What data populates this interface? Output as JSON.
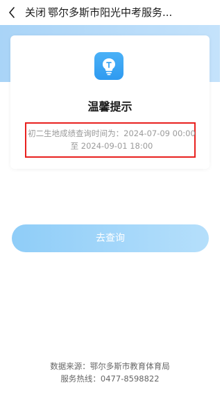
{
  "nav": {
    "back_icon": "chevron-left-icon",
    "close_label": "关闭",
    "title": "鄂尔多斯市阳光中考服务..."
  },
  "card": {
    "icon": "lightbulb-icon",
    "title": "温馨提示",
    "notice_line1": "初二生地成绩查询时间为：2024-07-09 00:00",
    "notice_line2": "至 2024-09-01 18:00"
  },
  "query_button_label": "去查询",
  "footer": {
    "source": "数据来源：鄂尔多斯市教育体育局",
    "hotline": "服务热线：0477-8598822"
  },
  "colors": {
    "accent": "#2f9af0",
    "button_bg": "#a3d6f9",
    "highlight_border": "#e8201e"
  }
}
